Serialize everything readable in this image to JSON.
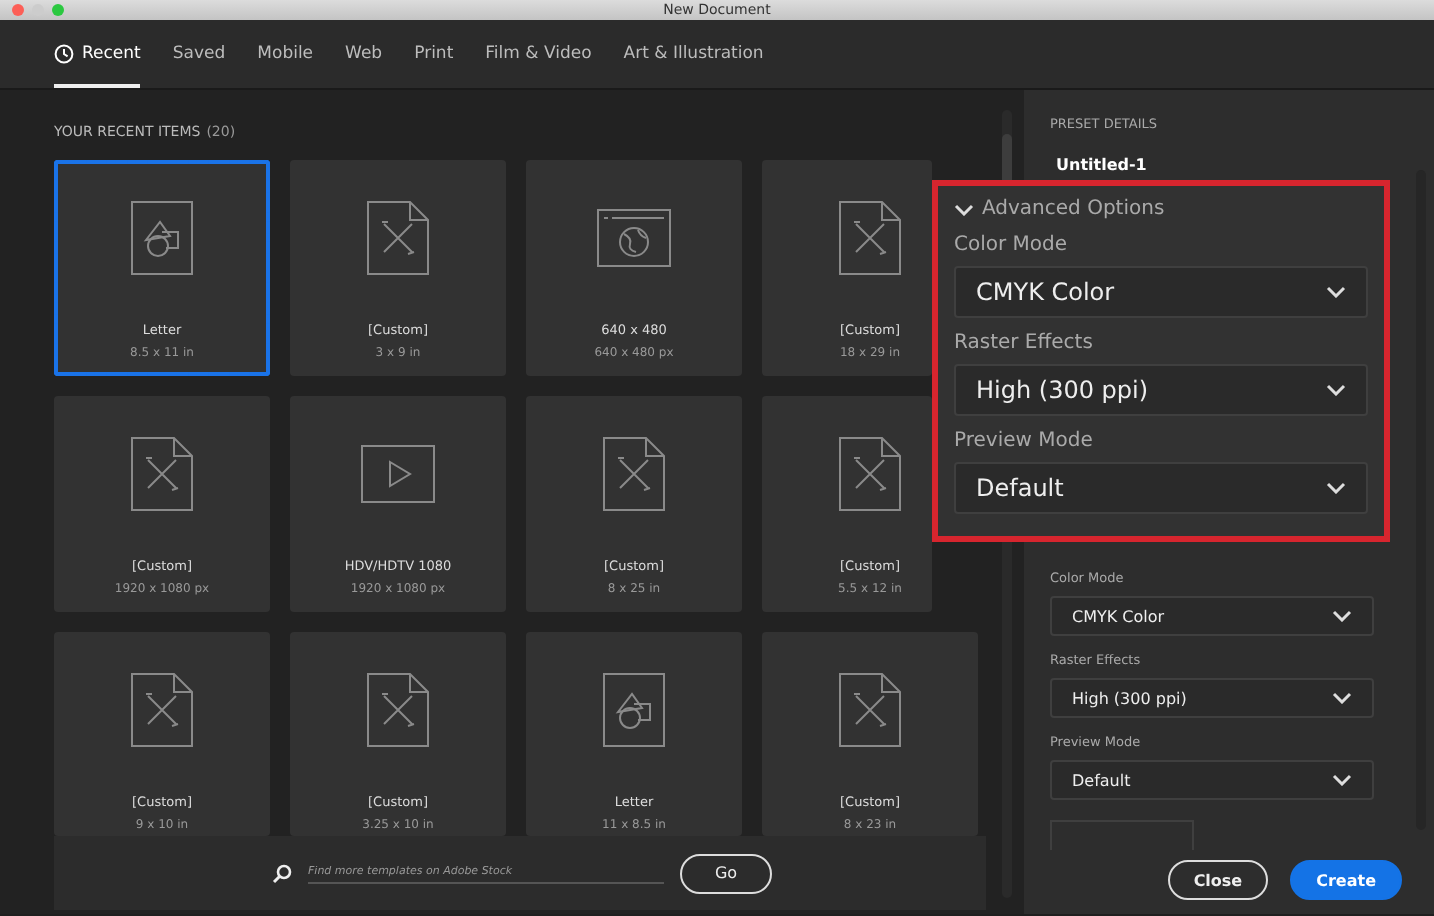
{
  "window": {
    "title": "New Document"
  },
  "tabs": [
    {
      "label": "Recent",
      "selected": true,
      "kind": "clock"
    },
    {
      "label": "Saved",
      "selected": false,
      "kind": "plain"
    },
    {
      "label": "Mobile",
      "selected": false,
      "kind": "plain"
    },
    {
      "label": "Web",
      "selected": false,
      "kind": "plain"
    },
    {
      "label": "Print",
      "selected": false,
      "kind": "plain"
    },
    {
      "label": "Film & Video",
      "selected": false,
      "kind": "plain"
    },
    {
      "label": "Art & Illustration",
      "selected": false,
      "kind": "plain"
    }
  ],
  "recent": {
    "heading": "YOUR RECENT ITEMS",
    "count": "(20)",
    "items": [
      {
        "name": "Letter",
        "size": "8.5 x 11 in",
        "kind": "shapes",
        "selected": true
      },
      {
        "name": "[Custom]",
        "size": "3 x 9 in",
        "kind": "custom",
        "selected": false
      },
      {
        "name": "640 x 480",
        "size": "640 x 480 px",
        "kind": "web",
        "selected": false
      },
      {
        "name": "[Custom]",
        "size": "18 x 29 in",
        "kind": "custom",
        "selected": false
      },
      {
        "name": "[Custom]",
        "size": "1920 x 1080 px",
        "kind": "custom",
        "selected": false
      },
      {
        "name": "HDV/HDTV 1080",
        "size": "1920 x 1080 px",
        "kind": "video",
        "selected": false
      },
      {
        "name": "[Custom]",
        "size": "8 x 25 in",
        "kind": "custom",
        "selected": false
      },
      {
        "name": "[Custom]",
        "size": "5.5 x 12 in",
        "kind": "custom",
        "selected": false
      },
      {
        "name": "[Custom]",
        "size": "9 x 10 in",
        "kind": "custom",
        "selected": false
      },
      {
        "name": "[Custom]",
        "size": "3.25 x 10 in",
        "kind": "custom",
        "selected": false
      },
      {
        "name": "Letter",
        "size": "11 x 8.5 in",
        "kind": "shapes",
        "selected": false
      },
      {
        "name": "[Custom]",
        "size": "8 x 23 in",
        "kind": "custom",
        "selected": false
      }
    ]
  },
  "search": {
    "placeholder": "Find more templates on Adobe Stock",
    "button": "Go"
  },
  "preset_details": {
    "heading": "PRESET DETAILS",
    "name": "Untitled-1",
    "fields": [
      {
        "label": "Color Mode",
        "value": "CMYK Color"
      },
      {
        "label": "Raster Effects",
        "value": "High (300 ppi)"
      },
      {
        "label": "Preview Mode",
        "value": "Default"
      }
    ],
    "buttons": [
      {
        "label": "Close",
        "kind": "secondary"
      },
      {
        "label": "Create",
        "kind": "primary"
      }
    ]
  },
  "callout": {
    "heading": "Advanced Options",
    "expanded": true,
    "fields": [
      {
        "label": "Color Mode",
        "value": "CMYK Color"
      },
      {
        "label": "Raster Effects",
        "value": "High (300 ppi)"
      },
      {
        "label": "Preview Mode",
        "value": "Default"
      }
    ]
  }
}
